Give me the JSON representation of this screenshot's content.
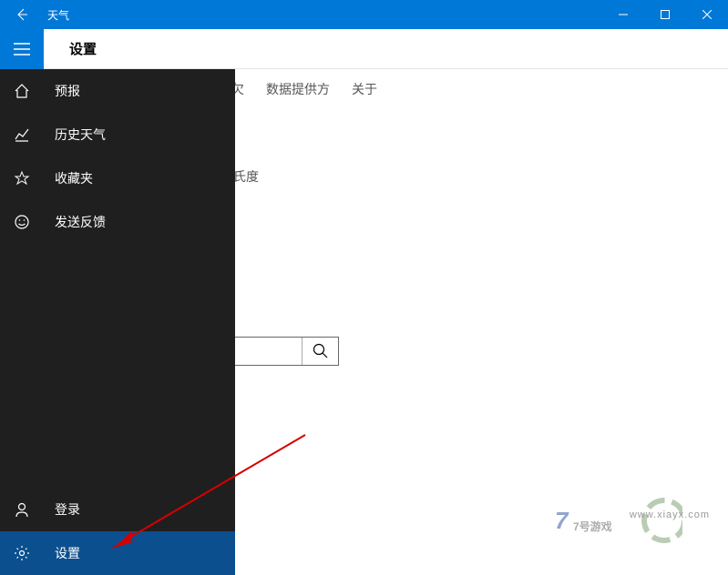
{
  "titlebar": {
    "title": "天气"
  },
  "subheader": {
    "title": "设置"
  },
  "tabs": {
    "partial_pref": "欠",
    "data_provider": "数据提供方",
    "about": "关于"
  },
  "settings": {
    "partial_unit_label": "氏度"
  },
  "sidebar": {
    "items": [
      {
        "label": "预报"
      },
      {
        "label": "历史天气"
      },
      {
        "label": "收藏夹"
      },
      {
        "label": "发送反馈"
      }
    ],
    "bottom": [
      {
        "label": "登录"
      },
      {
        "label": "设置"
      }
    ]
  },
  "watermark": {
    "text": "7号游戏",
    "url": "www.xiayx.com"
  }
}
